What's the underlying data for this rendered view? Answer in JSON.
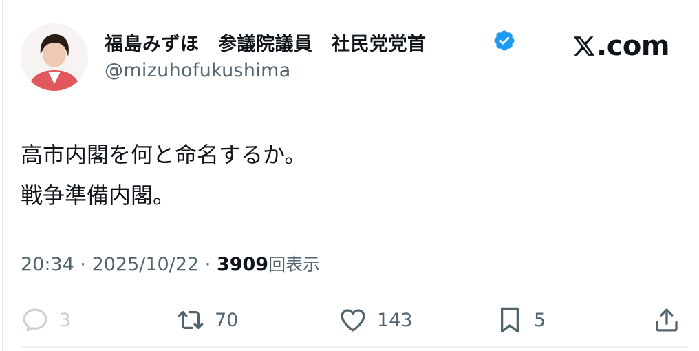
{
  "author": {
    "display_name": "福島みずほ　参議院議員　社民党党首",
    "handle": "@mizuhofukushima",
    "verified": true
  },
  "brand": {
    "label": ".com",
    "icon": "x-logo-icon"
  },
  "post": {
    "lines": [
      "高市内閣を何と命名するか。",
      "戦争準備内閣。"
    ]
  },
  "meta": {
    "time": "20:34",
    "separator": " · ",
    "date": "2025/10/22",
    "views": "3909",
    "views_label": "回表示"
  },
  "actions": {
    "replies": "3",
    "reposts": "70",
    "likes": "143",
    "bookmarks": "5"
  },
  "colors": {
    "text": "#0f1419",
    "secondary": "#536471",
    "verified_blue": "#1d9bf0",
    "faded": "#c9d1d6"
  }
}
